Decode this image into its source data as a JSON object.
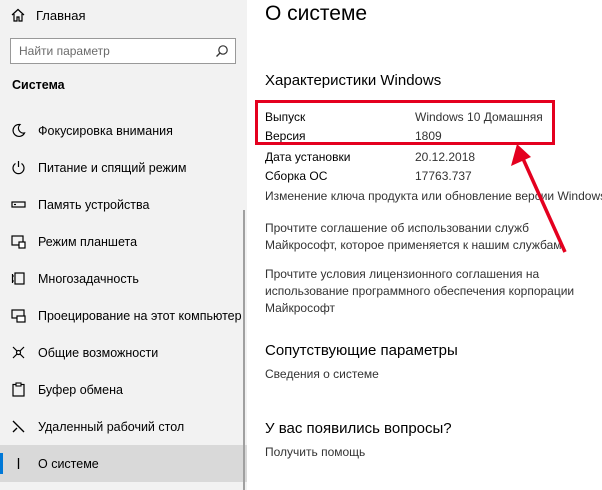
{
  "sidebar": {
    "home_label": "Главная",
    "search_placeholder": "Найти параметр",
    "section_title": "Система",
    "items": [
      {
        "label": "Фокусировка внимания",
        "icon": "moon-icon"
      },
      {
        "label": "Питание и спящий режим",
        "icon": "power-icon"
      },
      {
        "label": "Память устройства",
        "icon": "storage-icon"
      },
      {
        "label": "Режим планшета",
        "icon": "tablet-icon"
      },
      {
        "label": "Многозадачность",
        "icon": "multitask-icon"
      },
      {
        "label": "Проецирование на этот компьютер",
        "icon": "project-icon"
      },
      {
        "label": "Общие возможности",
        "icon": "share-icon"
      },
      {
        "label": "Буфер обмена",
        "icon": "clipboard-icon"
      },
      {
        "label": "Удаленный рабочий стол",
        "icon": "remote-icon"
      },
      {
        "label": "О системе",
        "icon": "info-icon",
        "active": true
      }
    ]
  },
  "main": {
    "title": "О системе",
    "spec_heading": "Характеристики Windows",
    "specs": [
      {
        "label": "Выпуск",
        "value": "Windows 10 Домашняя"
      },
      {
        "label": "Версия",
        "value": "1809"
      },
      {
        "label": "Дата установки",
        "value": "20.12.2018"
      },
      {
        "label": "Сборка ОС",
        "value": "17763.737"
      }
    ],
    "links": [
      "Изменение ключа продукта или обновление версии Windows",
      "Прочтите соглашение об использовании служб Майкрософт, которое применяется к нашим службам",
      "Прочтите условия лицензионного соглашения на использование программного обеспечения корпорации Майкрософт"
    ],
    "related_heading": "Сопутствующие параметры",
    "related_link": "Сведения о системе",
    "questions_heading": "У вас появились вопросы?",
    "help_link": "Получить помощь"
  },
  "colors": {
    "accent": "#0078d7",
    "highlight": "#e4001f"
  }
}
